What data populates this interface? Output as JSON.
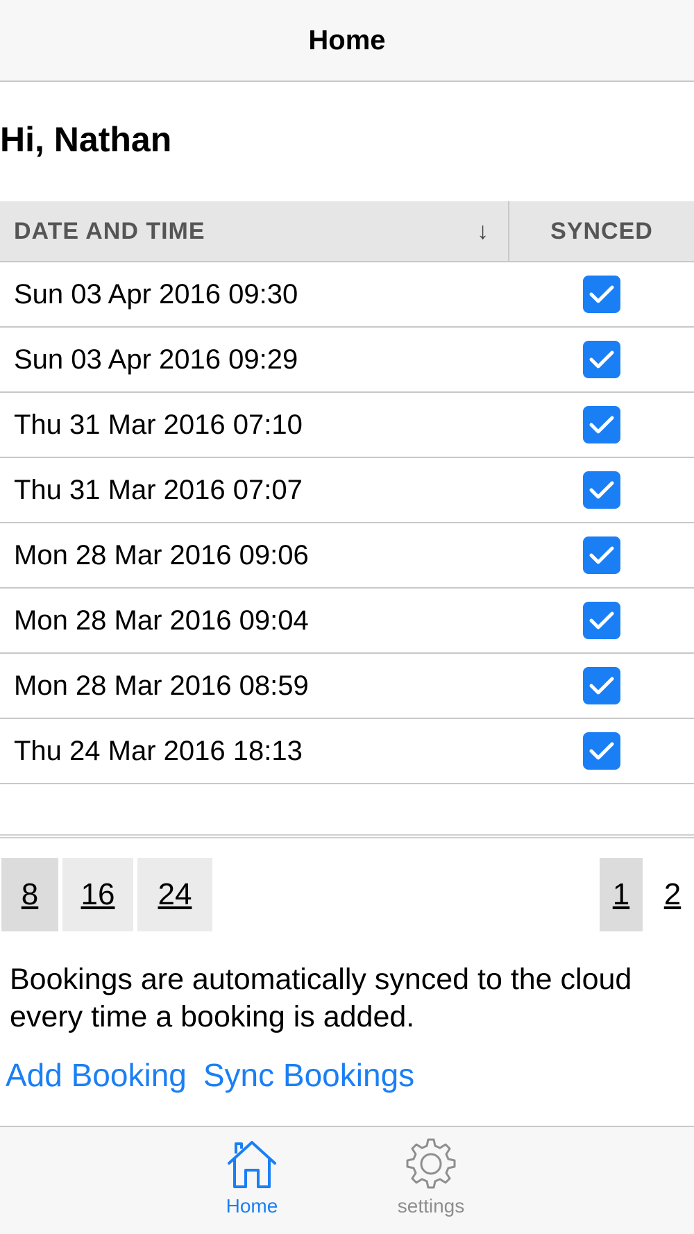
{
  "navbar": {
    "title": "Home"
  },
  "greeting": "Hi, Nathan",
  "grid": {
    "columns": {
      "date": "DATE AND TIME",
      "synced": "SYNCED"
    },
    "sort_direction": "descending",
    "rows": [
      {
        "date": "Sun 03 Apr 2016 09:30",
        "synced": true
      },
      {
        "date": "Sun 03 Apr 2016 09:29",
        "synced": true
      },
      {
        "date": "Thu 31 Mar 2016 07:10",
        "synced": true
      },
      {
        "date": "Thu 31 Mar 2016 07:07",
        "synced": true
      },
      {
        "date": "Mon 28 Mar 2016 09:06",
        "synced": true
      },
      {
        "date": "Mon 28 Mar 2016 09:04",
        "synced": true
      },
      {
        "date": "Mon 28 Mar 2016 08:59",
        "synced": true
      },
      {
        "date": "Thu 24 Mar 2016 18:13",
        "synced": true
      }
    ]
  },
  "pager": {
    "page_sizes": [
      "8",
      "16",
      "24"
    ],
    "selected_page_size": "8",
    "pages": [
      "1",
      "2"
    ],
    "current_page": "1"
  },
  "info_text": "Bookings are automatically synced to the cloud every time a booking is added.",
  "links": {
    "add": "Add Booking",
    "sync": "Sync Bookings"
  },
  "tabbar": {
    "home_label": "Home",
    "settings_label": "settings",
    "home_icon": "home-icon",
    "settings_icon": "gear-icon"
  },
  "colors": {
    "accent": "#1a7ff5",
    "inactive_tab": "#8e8e8e"
  }
}
